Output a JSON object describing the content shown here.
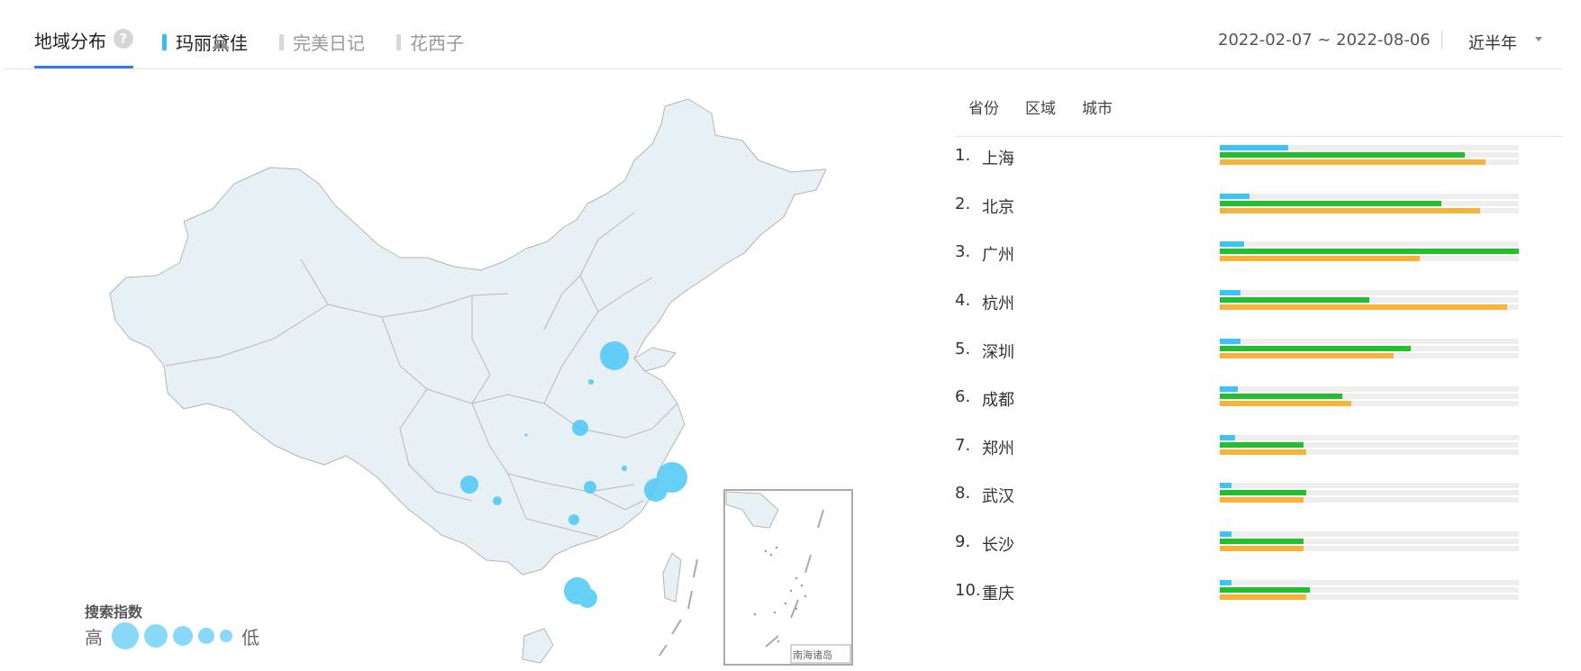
{
  "header": {
    "title": "地域分布",
    "help": "?",
    "brands": [
      {
        "label": "玛丽黛佳",
        "color": "#34c0ef",
        "active": true
      },
      {
        "label": "完美日记",
        "color": "#d8d8d8",
        "active": false
      },
      {
        "label": "花西子",
        "color": "#d8d8d8",
        "active": false
      }
    ],
    "date_range": "2022-02-07 ~ 2022-08-06",
    "period": "近半年"
  },
  "map": {
    "legend_title": "搜索指数",
    "legend_high": "高",
    "legend_low": "低",
    "inset_label": "南海诸岛"
  },
  "subtabs": [
    "省份",
    "区域",
    "城市"
  ],
  "colors": {
    "series_a": "#3cc4f2",
    "series_b": "#22c02c",
    "series_c": "#f7b23a",
    "track": "#eeeeee"
  },
  "ranking": [
    {
      "rank": "1.",
      "city": "上海",
      "a": 0.23,
      "b": 0.82,
      "c": 0.89
    },
    {
      "rank": "2.",
      "city": "北京",
      "a": 0.1,
      "b": 0.74,
      "c": 0.87
    },
    {
      "rank": "3.",
      "city": "广州",
      "a": 0.08,
      "b": 1.0,
      "c": 0.67
    },
    {
      "rank": "4.",
      "city": "杭州",
      "a": 0.07,
      "b": 0.5,
      "c": 0.96
    },
    {
      "rank": "5.",
      "city": "深圳",
      "a": 0.07,
      "b": 0.64,
      "c": 0.58
    },
    {
      "rank": "6.",
      "city": "成都",
      "a": 0.06,
      "b": 0.41,
      "c": 0.44
    },
    {
      "rank": "7.",
      "city": "郑州",
      "a": 0.05,
      "b": 0.28,
      "c": 0.29
    },
    {
      "rank": "8.",
      "city": "武汉",
      "a": 0.04,
      "b": 0.29,
      "c": 0.28
    },
    {
      "rank": "9.",
      "city": "长沙",
      "a": 0.04,
      "b": 0.28,
      "c": 0.28
    },
    {
      "rank": "10.",
      "city": "重庆",
      "a": 0.04,
      "b": 0.3,
      "c": 0.29
    }
  ]
}
